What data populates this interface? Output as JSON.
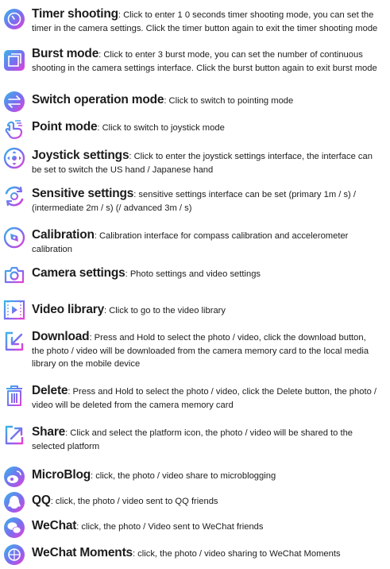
{
  "items": [
    {
      "icon": "timer-icon",
      "title": "Timer shooting",
      "desc": ": Click to enter 1 0 seconds timer shooting mode, you can set the timer in the camera settings. Click the timer button again to exit the timer shooting mode"
    },
    {
      "icon": "burst-icon",
      "title": "Burst mode",
      "desc": ": Click to enter 3 burst mode, you can set the number of continuous shooting in the camera settings interface. Click the burst button again to exit burst mode"
    },
    {
      "icon": "switch-arrows-icon",
      "title": "Switch operation mode",
      "desc": ": Click to switch to pointing mode"
    },
    {
      "icon": "point-hand-icon",
      "title": "Point mode",
      "desc": ": Click to switch to joystick mode"
    },
    {
      "icon": "joystick-icon",
      "title": "Joystick settings",
      "desc": ": Click to enter the joystick settings interface, the interface can be set to switch the US hand / Japanese hand"
    },
    {
      "icon": "sensitivity-icon",
      "title": "Sensitive settings",
      "desc": ": sensitive settings interface can be set (primary 1m / s) / (intermediate 2m / s) (/ advanced 3m / s)"
    },
    {
      "icon": "compass-icon",
      "title": "Calibration",
      "desc": ": Calibration interface for compass calibration and accelerometer calibration"
    },
    {
      "icon": "camera-icon",
      "title": "Camera settings",
      "desc": ": Photo settings and video settings"
    },
    {
      "icon": "video-library-icon",
      "title": "Video library",
      "desc": ": Click to go to the video library"
    },
    {
      "icon": "download-icon",
      "title": "Download",
      "desc": ": Press and Hold to select the photo / video, click the download button, the photo / video will be downloaded from the camera memory card to the local media library on the mobile device"
    },
    {
      "icon": "trash-icon",
      "title": "Delete",
      "desc": ": Press and Hold to select the photo / video, click the Delete button, the photo / video will be deleted from the camera memory card"
    },
    {
      "icon": "share-icon",
      "title": "Share",
      "desc": ": Click and select the platform icon, the photo / video will be shared to the selected platform"
    },
    {
      "icon": "microblog-icon",
      "title": "MicroBlog",
      "desc": ": click, the photo / video share to microblogging"
    },
    {
      "icon": "qq-icon",
      "title": "QQ",
      "desc": ": click, the photo / video sent to QQ friends"
    },
    {
      "icon": "wechat-icon",
      "title": "WeChat",
      "desc": ": click, the photo / Video sent to WeChat friends"
    },
    {
      "icon": "wechat-moments-icon",
      "title": "WeChat Moments",
      "desc": ": click, the photo / video sharing to WeChat Moments"
    }
  ]
}
